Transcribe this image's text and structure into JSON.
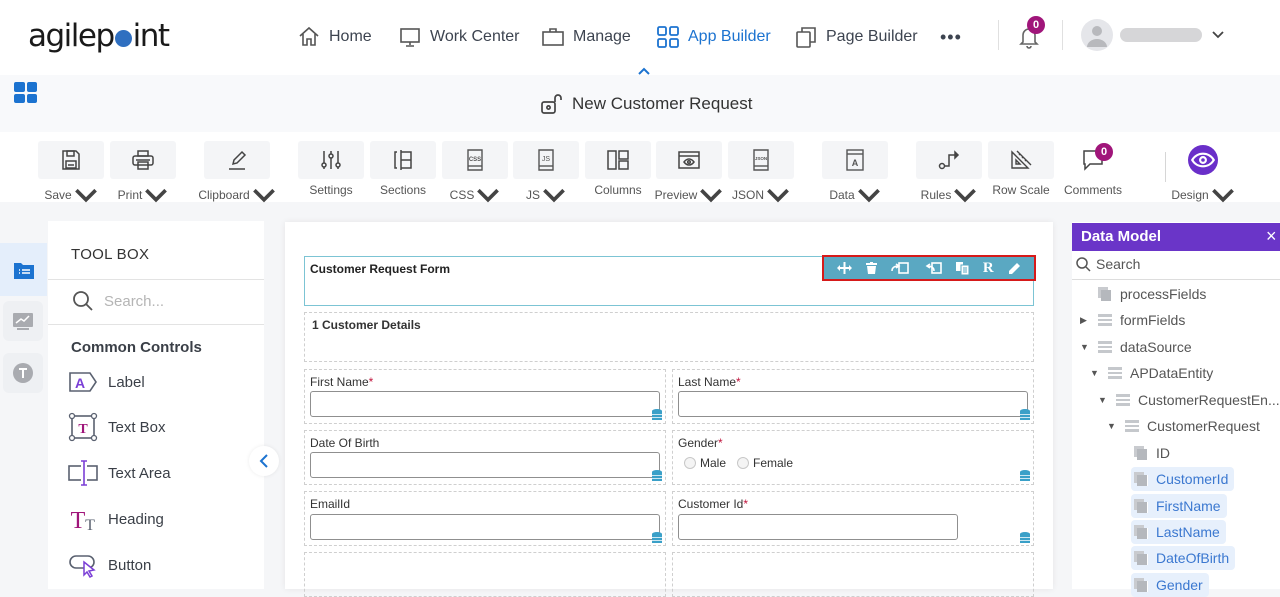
{
  "topnav": {
    "logo": {
      "pre": "agilep",
      "post": "int"
    },
    "items": [
      {
        "label": "Home",
        "icon": "home-icon"
      },
      {
        "label": "Work Center",
        "icon": "monitor-icon"
      },
      {
        "label": "Manage",
        "icon": "briefcase-icon"
      },
      {
        "label": "App Builder",
        "icon": "grid-icon",
        "active": true
      },
      {
        "label": "Page Builder",
        "icon": "pages-icon"
      }
    ],
    "more": "•••",
    "notifications_count": "0",
    "user_name": "",
    "collapse": "^"
  },
  "subheader": {
    "title": "New Customer Request"
  },
  "toolbar": {
    "items": [
      {
        "label": "Save",
        "dropdown": true
      },
      {
        "label": "Print",
        "dropdown": true
      },
      {
        "label": "Clipboard",
        "dropdown": true
      },
      {
        "label": "Settings",
        "dropdown": false
      },
      {
        "label": "Sections",
        "dropdown": false
      },
      {
        "label": "CSS",
        "dropdown": true
      },
      {
        "label": "JS",
        "dropdown": true
      },
      {
        "label": "Columns",
        "dropdown": false
      },
      {
        "label": "Preview",
        "dropdown": true
      },
      {
        "label": "JSON",
        "dropdown": true
      },
      {
        "label": "Data",
        "dropdown": true
      },
      {
        "label": "Rules",
        "dropdown": true
      },
      {
        "label": "Row Scale",
        "dropdown": false
      },
      {
        "label": "Comments",
        "dropdown": false
      },
      {
        "label": "Design",
        "dropdown": true
      }
    ],
    "comments_count": "0"
  },
  "toolbox": {
    "title": "TOOL BOX",
    "search_placeholder": "Search...",
    "section": "Common Controls",
    "items": [
      "Label",
      "Text Box",
      "Text Area",
      "Heading",
      "Button"
    ]
  },
  "form": {
    "header_title": "Customer Request Form",
    "control_bar": [
      "move",
      "delete",
      "move-in",
      "move-out",
      "copy",
      "R",
      "edit"
    ],
    "section_title": "1 Customer Details",
    "fields": {
      "first_name": {
        "label": "First Name",
        "required": "*",
        "value": ""
      },
      "last_name": {
        "label": "Last Name",
        "required": "*",
        "value": ""
      },
      "dob": {
        "label": "Date Of Birth",
        "value": ""
      },
      "gender": {
        "label": "Gender",
        "required": "*",
        "options": [
          "Male",
          "Female"
        ]
      },
      "email": {
        "label": "EmailId",
        "value": ""
      },
      "customer_id": {
        "label": "Customer Id",
        "required": "*",
        "value": ""
      }
    }
  },
  "data_model": {
    "title": "Data Model",
    "close": "×",
    "search_placeholder": "Search",
    "tree": [
      {
        "label": "processFields",
        "type": "field",
        "level": 0
      },
      {
        "label": "formFields",
        "type": "table",
        "level": 0,
        "expand": "collapsed"
      },
      {
        "label": "dataSource",
        "type": "table",
        "level": 0,
        "expand": "expanded"
      },
      {
        "label": "APDataEntity",
        "type": "table",
        "level": 1,
        "expand": "expanded"
      },
      {
        "label": "CustomerRequestEn...",
        "type": "table",
        "level": 2,
        "expand": "expanded"
      },
      {
        "label": "CustomerRequest",
        "type": "table",
        "level": 3,
        "expand": "expanded"
      },
      {
        "label": "ID",
        "type": "field",
        "level": 4
      },
      {
        "label": "CustomerId",
        "type": "field",
        "level": 4,
        "highlighted": true
      },
      {
        "label": "FirstName",
        "type": "field",
        "level": 4,
        "highlighted": true
      },
      {
        "label": "LastName",
        "type": "field",
        "level": 4,
        "highlighted": true
      },
      {
        "label": "DateOfBirth",
        "type": "field",
        "level": 4,
        "highlighted": true
      },
      {
        "label": "Gender",
        "type": "field",
        "level": 4,
        "highlighted": true
      }
    ]
  },
  "colors": {
    "accent": "#1c73d0",
    "badge": "#a0157a",
    "data_model_header": "#6a35c8",
    "selection_border": "#d61a1a",
    "control_bar": "#5aa8c2"
  }
}
